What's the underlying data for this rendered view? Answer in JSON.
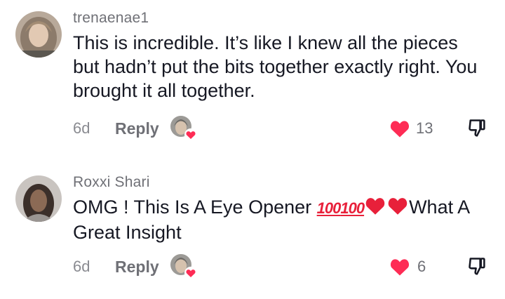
{
  "comments": [
    {
      "username": "trenaenae1",
      "text": "This is incredible. It’s like I knew all the pieces but hadn’t put the bits together exactly right. You brought it all together.",
      "age": "6d",
      "reply_label": "Reply",
      "likes": "13",
      "liked": true
    },
    {
      "username": "Roxxi Shari",
      "text_part1": "OMG ! This Is A Eye Opener ",
      "emoji_100": "100",
      "text_part2": "What A Great Insight",
      "age": "6d",
      "reply_label": "Reply",
      "likes": "6",
      "liked": true
    }
  ],
  "colors": {
    "like_red": "#fe2c55",
    "meta_gray": "#6f7076",
    "text": "#161823"
  },
  "icons": [
    "avatar",
    "creator-liked-badge-icon",
    "heart-icon",
    "dislike-icon"
  ]
}
